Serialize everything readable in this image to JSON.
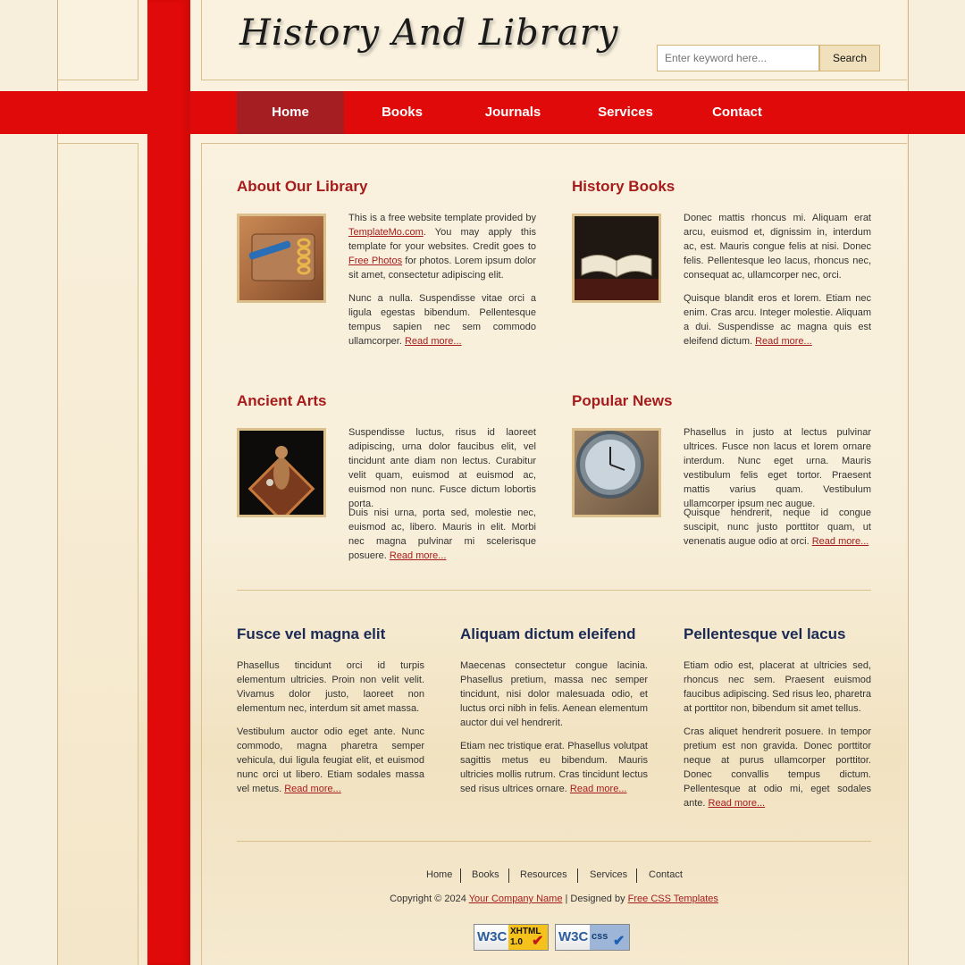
{
  "site": {
    "title": "History And Library"
  },
  "search": {
    "placeholder": "Enter keyword here...",
    "button_label": "Search"
  },
  "nav": {
    "items": [
      {
        "label": "Home",
        "active": true
      },
      {
        "label": "Books"
      },
      {
        "label": "Journals"
      },
      {
        "label": "Services"
      },
      {
        "label": "Contact"
      }
    ]
  },
  "sections": {
    "about": {
      "title": "About Our Library",
      "image": "notebook-photo",
      "p1_a": "This is a free website template provided by ",
      "p1_link1": "TemplateMo.com",
      "p1_b": ". You may apply this template for your websites. Credit goes to ",
      "p1_link2": "Free Photos",
      "p1_c": " for photos. Lorem ipsum dolor sit amet, consectetur adipiscing elit.",
      "p2": "Nunc a nulla. Suspendisse vitae orci a ligula egestas bibendum. Pellentesque tempus sapien nec sem commodo ullamcorper. ",
      "read_more": "Read more..."
    },
    "history_books": {
      "title": "History Books",
      "image": "open-book-photo",
      "p1": "Donec mattis rhoncus mi. Aliquam erat arcu, euismod et, dignissim in, interdum ac, est. Mauris congue felis at nisi. Donec felis. Pellentesque leo lacus, rhoncus nec, consequat ac, ullamcorper nec, orci.",
      "p2": "Quisque blandit eros et lorem. Etiam nec enim. Cras arcu. Integer molestie. Aliquam a dui. Suspendisse ac magna quis est eleifend dictum. ",
      "read_more": "Read more..."
    },
    "ancient_arts": {
      "title": "Ancient Arts",
      "image": "figurine-photo",
      "p1": "Suspendisse luctus, risus id laoreet adipiscing, urna dolor faucibus elit, vel tincidunt ante diam non lectus. Curabitur velit quam, euismod at euismod ac, euismod non nunc. Fusce dictum lobortis porta.",
      "p2": "Duis nisi urna, porta sed, molestie nec, euismod ac, libero. Mauris in elit. Morbi nec magna pulvinar mi scelerisque posuere. ",
      "read_more": "Read more..."
    },
    "popular_news": {
      "title": "Popular News",
      "image": "watch-photo",
      "p1": "Phasellus in justo at lectus pulvinar ultrices. Fusce non lacus et lorem ornare interdum. Nunc eget urna. Mauris vestibulum felis eget tortor. Praesent mattis varius quam. Vestibulum ullamcorper ipsum nec augue.",
      "p2": "Quisque hendrerit, neque id congue suscipit, nunc justo porttitor quam, ut venenatis augue odio at orci. ",
      "read_more": "Read more..."
    }
  },
  "columns": [
    {
      "title": "Fusce vel magna elit",
      "p1": "Phasellus tincidunt orci id turpis elementum ultricies. Proin non velit velit. Vivamus dolor justo, laoreet non elementum nec, interdum sit amet massa.",
      "p2": "Vestibulum auctor odio eget ante. Nunc commodo, magna pharetra semper vehicula, dui ligula feugiat elit, et euismod nunc orci ut libero. Etiam sodales massa vel metus. ",
      "read_more": "Read more..."
    },
    {
      "title": "Aliquam dictum eleifend",
      "p1": "Maecenas consectetur congue lacinia. Phasellus pretium, massa nec semper tincidunt, nisi dolor malesuada odio, et luctus orci nibh in felis. Aenean elementum auctor dui vel hendrerit.",
      "p2": "Etiam nec tristique erat. Phasellus volutpat sagittis metus eu bibendum. Mauris ultricies mollis rutrum. Cras tincidunt lectus sed risus ultrices ornare. ",
      "read_more": "Read more..."
    },
    {
      "title": "Pellentesque vel lacus",
      "p1": "Etiam odio est, placerat at ultricies sed, rhoncus nec sem. Praesent euismod faucibus adipiscing. Sed risus leo, pharetra at porttitor non, bibendum sit amet tellus.",
      "p2": "Cras aliquet hendrerit posuere. In tempor pretium est non gravida. Donec porttitor neque at purus ullamcorper porttitor. Donec convallis tempus dictum. Pellentesque at odio mi, eget sodales ante. ",
      "read_more": "Read more..."
    }
  ],
  "footer": {
    "nav": [
      "Home",
      "Books",
      "Resources",
      "Services",
      "Contact"
    ],
    "copyright_prefix": "Copyright © 2024 ",
    "company_link": "Your Company Name",
    "designed_by": " | Designed by ",
    "designer_link": "Free CSS Templates",
    "badges": {
      "xhtml_w3c": "W3C",
      "xhtml_text": "XHTML",
      "xhtml_version": "1.0",
      "css_w3c": "W3C",
      "css_text": "css"
    }
  },
  "colors": {
    "accent_red": "#e10a0a",
    "nav_active": "#a51e22",
    "heading_red": "#a61c1c",
    "heading_navy": "#1b2a55"
  }
}
